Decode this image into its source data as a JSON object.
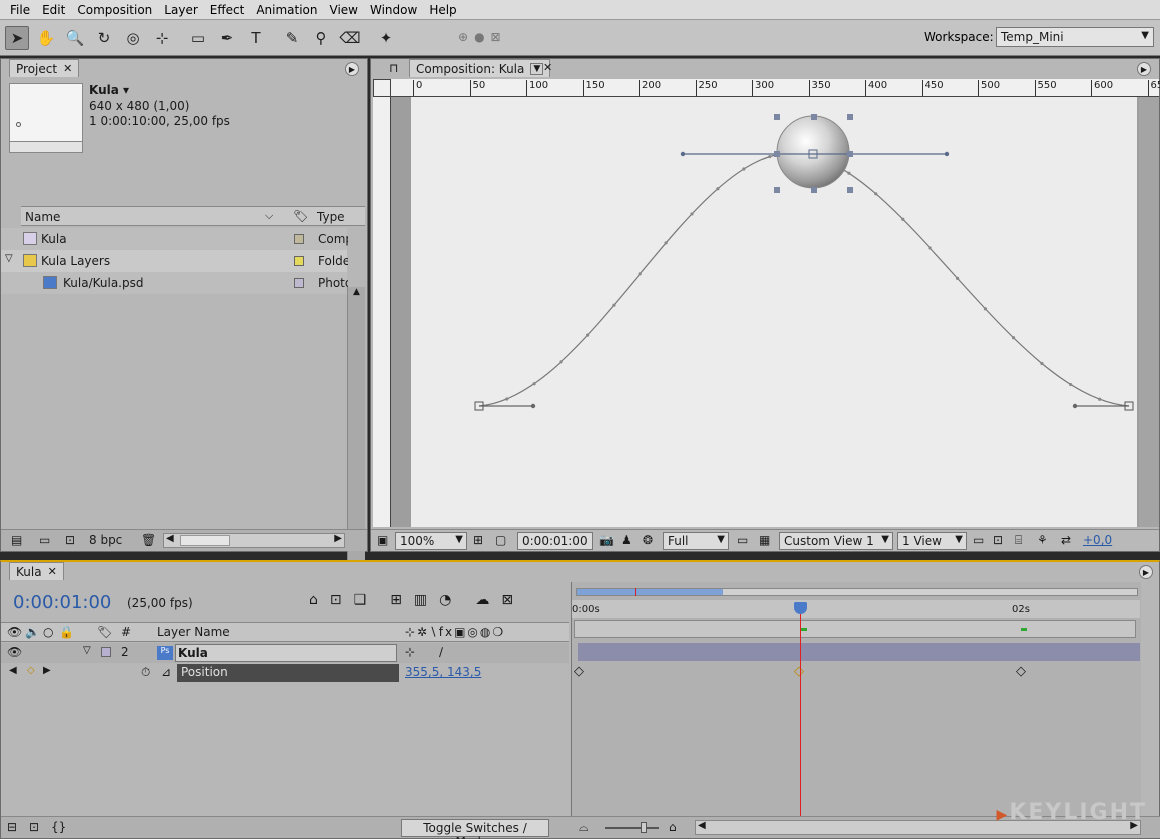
{
  "menu": [
    "File",
    "Edit",
    "Composition",
    "Layer",
    "Effect",
    "Animation",
    "View",
    "Window",
    "Help"
  ],
  "toolbar": {
    "tools": [
      {
        "name": "selection-tool-icon",
        "glyph": "➤",
        "active": true
      },
      {
        "name": "hand-tool-icon",
        "glyph": "✋"
      },
      {
        "name": "zoom-tool-icon",
        "glyph": "🔍"
      },
      {
        "name": "rotate-tool-icon",
        "glyph": "↻"
      },
      {
        "name": "orbit-camera-tool-icon",
        "glyph": "◎"
      },
      {
        "name": "pan-behind-tool-icon",
        "glyph": "⊹"
      },
      {
        "name": "rectangle-mask-tool-icon",
        "glyph": "▭"
      },
      {
        "name": "pen-tool-icon",
        "glyph": "✒"
      },
      {
        "name": "text-tool-icon",
        "glyph": "T"
      },
      {
        "name": "brush-tool-icon",
        "glyph": "✎"
      },
      {
        "name": "clone-stamp-tool-icon",
        "glyph": "⚲"
      },
      {
        "name": "eraser-tool-icon",
        "glyph": "⌫"
      },
      {
        "name": "puppet-pin-tool-icon",
        "glyph": "✦"
      }
    ],
    "workspace_label": "Workspace:",
    "workspace_value": "Temp_Mini"
  },
  "project": {
    "tab_label": "Project",
    "item_name": "Kula ▾",
    "item_dims": "640 x 480 (1,00)",
    "item_duration": "1 0:00:10:00, 25,00 fps",
    "columns": {
      "name": "Name",
      "type": "Type"
    },
    "rows": [
      {
        "label": "Kula",
        "type": "Comp",
        "color": "#c0b89a",
        "indent": 0,
        "icon": "composition-icon"
      },
      {
        "label": "Kula Layers",
        "type": "Folde",
        "color": "#e6d85a",
        "indent": 0,
        "icon": "folder-icon"
      },
      {
        "label": "Kula/Kula.psd",
        "type": "Photo",
        "color": "#c0b8d0",
        "indent": 1,
        "icon": "psd-file-icon"
      }
    ],
    "bpc": "8 bpc"
  },
  "comp": {
    "tab_label": "Composition: Kula",
    "ruler_ticks": [
      "0",
      "50",
      "100",
      "150",
      "200",
      "250",
      "300",
      "350",
      "400",
      "450",
      "500",
      "550",
      "600",
      "65"
    ],
    "zoom": "100%",
    "timecode": "0:00:01:00",
    "resolution": "Full",
    "view": "Custom View 1",
    "views": "1 View",
    "exposure": "+0,0"
  },
  "timeline": {
    "tab_label": "Kula",
    "timecode": "0:00:01:00",
    "fps": "(25,00 fps)",
    "col_layer_name": "Layer Name",
    "col_number": "#",
    "layer_number": "2",
    "layer_name": "Kula",
    "property_name": "Position",
    "property_value": "355,5, 143,5",
    "time_labels": [
      "0:00s",
      "02s"
    ],
    "toggle_label": "Toggle Switches / Modes"
  },
  "watermark": "KEYLIGHT"
}
